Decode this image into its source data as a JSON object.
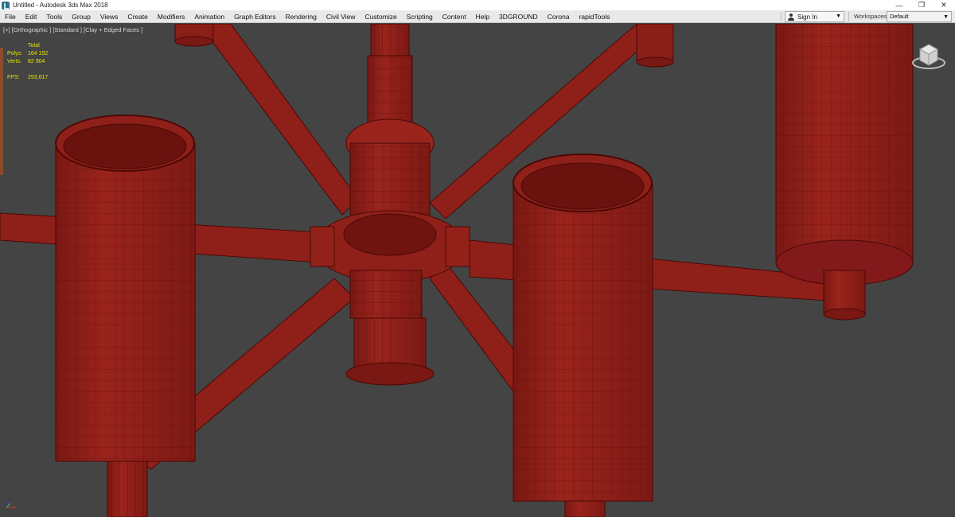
{
  "window": {
    "title": "Untitled - Autodesk 3ds Max 2018",
    "controls": {
      "minimize": "—",
      "maximize": "❐",
      "close": "✕"
    }
  },
  "menu": {
    "items": [
      "File",
      "Edit",
      "Tools",
      "Group",
      "Views",
      "Create",
      "Modifiers",
      "Animation",
      "Graph Editors",
      "Rendering",
      "Civil View",
      "Customize",
      "Scripting",
      "Content",
      "Help",
      "3DGROUND",
      "Corona",
      "rapidTools"
    ],
    "signin_label": "Sign In",
    "workspaces_label": "Workspaces:",
    "workspace_value": "Default"
  },
  "viewport": {
    "label": "[+] [Orthographic ] [Standard ] [Clay + Edged Faces ]",
    "stats": {
      "total_label": "Total",
      "polys_label": "Polys:",
      "polys_value": "164 192",
      "verts_label": "Verts:",
      "verts_value": "82 904",
      "fps_label": "FPS:",
      "fps_value": "293,617"
    },
    "colors": {
      "background": "#444444",
      "clay": "#8e1f19",
      "clay_dark": "#5a0f0b",
      "stats": "#e6e600"
    }
  }
}
